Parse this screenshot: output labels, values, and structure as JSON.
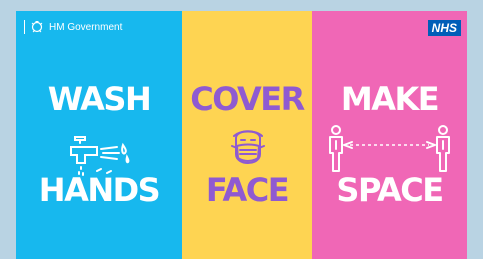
{
  "header": {
    "government_label": "HM Government",
    "nhs_logo": "NHS"
  },
  "panels": [
    {
      "top": "WASH",
      "bottom": "HANDS",
      "color": "#17b8ee",
      "icon": "tap-icon"
    },
    {
      "top": "COVER",
      "bottom": "FACE",
      "color": "#fed452",
      "icon": "face-mask-icon"
    },
    {
      "top": "MAKE",
      "bottom": "SPACE",
      "color": "#f067b6",
      "icon": "social-distance-icon"
    }
  ],
  "colors": {
    "background": "#b9d3e3",
    "cover_text": "#8f5ad1",
    "nhs_blue": "#005eb8"
  }
}
